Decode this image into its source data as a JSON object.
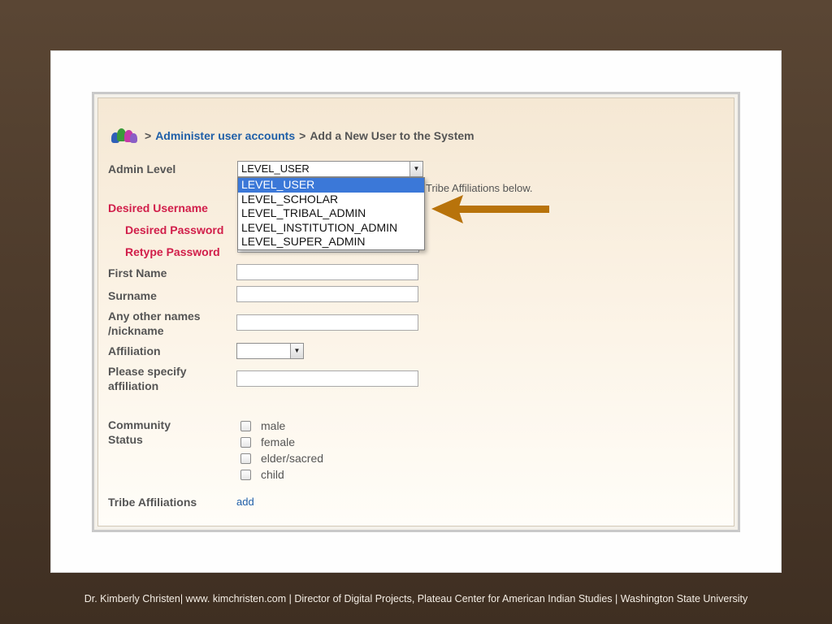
{
  "breadcrumb": {
    "sep1": ">",
    "link": "Administer user accounts",
    "sep2": ">",
    "current": "Add a New User to the System"
  },
  "form": {
    "admin_level": {
      "label": "Admin Level",
      "value": "LEVEL_USER"
    },
    "admin_level_options": [
      "LEVEL_USER",
      "LEVEL_SCHOLAR",
      "LEVEL_TRIBAL_ADMIN",
      "LEVEL_INSTITUTION_ADMIN",
      "LEVEL_SUPER_ADMIN"
    ],
    "hint_text": "Tribe Affiliations below.",
    "desired_username": {
      "label": "Desired Username"
    },
    "desired_password": {
      "label": "Desired Password"
    },
    "retype_password": {
      "label": "Retype Password"
    },
    "first_name": {
      "label": "First Name"
    },
    "surname": {
      "label": "Surname"
    },
    "other_names": {
      "label_line1": "Any other names",
      "label_line2": "/nickname"
    },
    "affiliation": {
      "label": "Affiliation",
      "value": ""
    },
    "specify_affiliation": {
      "label_line1": "Please specify",
      "label_line2": "affiliation"
    },
    "community_status": {
      "label_line1": "Community",
      "label_line2": "Status",
      "options": [
        "male",
        "female",
        "elder/sacred",
        "child"
      ]
    },
    "tribe_affiliations": {
      "label": "Tribe Affiliations",
      "link": "add"
    }
  },
  "footer": "Dr. Kimberly Christen| www. kimchristen.com | Director of Digital Projects, Plateau Center for American Indian Studies | Washington State University",
  "colors": {
    "background": "#4a382a",
    "link": "#1f5fa8",
    "required_label": "#d11e4a",
    "selected_option": "#3b78d8",
    "arrow": "#b8730b"
  }
}
